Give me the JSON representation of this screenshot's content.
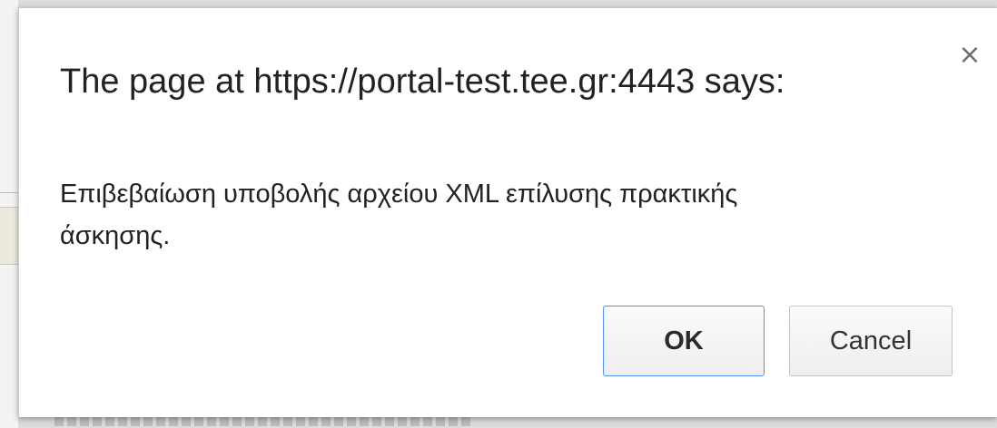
{
  "dialog": {
    "title": "The page at https://portal-test.tee.gr:4443 says:",
    "message_line1": "Επιβεβαίωση υποβολής αρχείου XML επίλυσης πρακτικής",
    "message_line2": "άσκησης.",
    "close_glyph": "×",
    "ok_label": "OK",
    "cancel_label": "Cancel",
    "ok_border_color": "#4d90fe"
  }
}
